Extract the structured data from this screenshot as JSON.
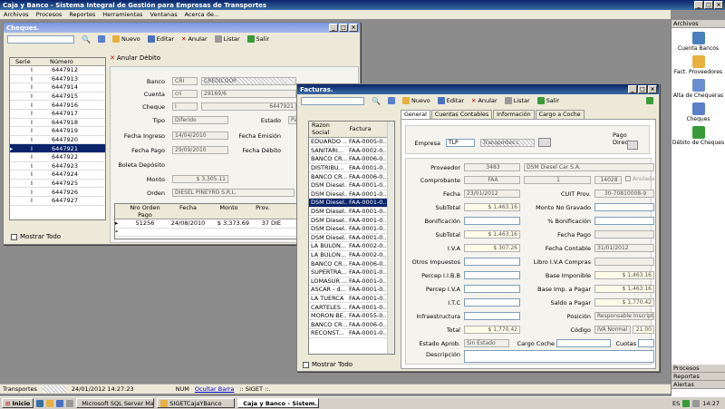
{
  "app": {
    "title": "Caja y Banco - Sistema Integral de Gestión para Empresas de Transportes",
    "menu": [
      "Archivos",
      "Procesos",
      "Reportes",
      "Herramientas",
      "Ventanas",
      "Acerca de..."
    ]
  },
  "cheques_win": {
    "title": "Cheques.",
    "toolbar": {
      "nuevo": "Nuevo",
      "editar": "Editar",
      "anular": "Anular",
      "listar": "Listar",
      "salir": "Salir"
    },
    "grid_headers": [
      "Serie",
      "Número"
    ],
    "rows": [
      [
        "I",
        "6447912"
      ],
      [
        "I",
        "6447913"
      ],
      [
        "I",
        "6447914"
      ],
      [
        "I",
        "6447915"
      ],
      [
        "I",
        "6447916"
      ],
      [
        "I",
        "6447917"
      ],
      [
        "I",
        "6447918"
      ],
      [
        "I",
        "6447919"
      ],
      [
        "I",
        "6447920"
      ],
      [
        "I",
        "6447921"
      ],
      [
        "I",
        "6447922"
      ],
      [
        "I",
        "6447923"
      ],
      [
        "I",
        "6447924"
      ],
      [
        "I",
        "6447925"
      ],
      [
        "I",
        "6447926"
      ],
      [
        "I",
        "6447927"
      ]
    ],
    "mostrar_todo": "Mostrar Todo",
    "anular_debito": "Anular Débito",
    "form": {
      "banco_label": "Banco",
      "banco_code": "CRI",
      "banco_name": "CREDICOOP",
      "cuenta_label": "Cuenta",
      "cuenta_code": "cri",
      "cuenta_num": "29169/6",
      "cheque_label": "Cheque",
      "cheque_serie": "I",
      "cheque_num": "6447921",
      "tipo_label": "Tipo",
      "tipo_value": "Diferido",
      "estado_label": "Estado",
      "estado_value": "Pa",
      "fingreso_label": "Fecha Ingreso",
      "fingreso_value": "14/04/2010",
      "femision_label": "Fecha Emisión",
      "fpago_label": "Fecha Pago",
      "fpago_value": "29/09/2010",
      "fdebito_label": "Fecha Débito",
      "boleta_label": "Boleta Depósito",
      "monto_label": "Monto",
      "monto_value": "$ 3,305.11",
      "orden_label": "Orden",
      "orden_value": "DIESEL PIÑEYRO S.R.L."
    },
    "sub_headers": [
      "Nro Orden Pago",
      "Fecha",
      "Monto",
      "Prov."
    ],
    "sub_row": [
      "51256",
      "24/08/2010",
      "$ 3,373.69",
      "37",
      "DIE"
    ]
  },
  "facturas_win": {
    "title": "Facturas.",
    "toolbar": {
      "nuevo": "Nuevo",
      "editar": "Editar",
      "anular": "Anular",
      "listar": "Listar",
      "salir": "Salir"
    },
    "grid_headers": [
      "Razon Social",
      "Factura"
    ],
    "rows": [
      [
        "EDUARDO ...",
        "FAA-0005-0..."
      ],
      [
        "SANITARI...",
        "FAA-0002-0..."
      ],
      [
        "BANCO CR...",
        "FAA-0006-0..."
      ],
      [
        "DISTRIBU...",
        "FAA-0001-0..."
      ],
      [
        "BANCO CR...",
        "FAA-0006-0..."
      ],
      [
        "DSM Diesel...",
        "FAA-0001-0..."
      ],
      [
        "DSM Diesel...",
        "FAA-0001-0..."
      ],
      [
        "DSM Diesel...",
        "FAA-0001-0..."
      ],
      [
        "DSM Diesel...",
        "FAA-0001-0..."
      ],
      [
        "DSM Diesel...",
        "FAA-0001-0..."
      ],
      [
        "DSM Diesel...",
        "FAA-0001-0..."
      ],
      [
        "DSM Diesel...",
        "FAA-0001-0..."
      ],
      [
        "LA BULON...",
        "FAA-0002-0..."
      ],
      [
        "LA BULON...",
        "FAA-0002-0..."
      ],
      [
        "BANCO CR...",
        "FAA-0006-0..."
      ],
      [
        "SUPERTRA...",
        "FAA-0001-0..."
      ],
      [
        "LOMASUR ...",
        "FAA-0001-0..."
      ],
      [
        "ASCAR - d...",
        "FAA-0001-0..."
      ],
      [
        "LA TUERCA",
        "FAA-0001-0..."
      ],
      [
        "CARTELES ...",
        "FAA-0001-0..."
      ],
      [
        "MORON BE...",
        "FAA-0055-0..."
      ],
      [
        "BANCO CR...",
        "FAA-0006-0..."
      ],
      [
        "RECONST...",
        "FAA-0001-0..."
      ]
    ],
    "selected_index": 7,
    "mostrar_todo": "Mostrar Todo",
    "tabs": [
      "General",
      "Cuentas Contables",
      "Información",
      "Cargo a Coche"
    ],
    "empresa_label": "Empresa",
    "empresa_code": "TLP",
    "empresa_name": "Transportes L",
    "pago_directo": "Pago Directo",
    "f": {
      "proveedor_l": "Proveedor",
      "proveedor_code": "3483",
      "proveedor_name": "DSM Diesel Car S.A.",
      "comprobante_l": "Comprobante",
      "comp_tipo": "FAA",
      "comp_pv": "1",
      "comp_num": "14028",
      "anulada": "Anulada",
      "fecha_l": "Fecha",
      "fecha_v": "23/01/2012",
      "cuit_l": "CUIT Prov.",
      "cuit_v": "30-70810008-9",
      "subtotal_l": "SubTotal",
      "subtotal_v": "$ 1,463.16",
      "montong_l": "Monto No Gravado",
      "bonif_l": "Bonificación",
      "pbonif_l": "% Bonificación",
      "subtotal2_l": "SubTotal",
      "subtotal2_v": "$ 1,463.16",
      "fpago_l": "Fecha Pago",
      "iva_l": "I.V.A",
      "iva_v": "$ 307.26",
      "fcont_l": "Fecha Contable",
      "fcont_v": "31/01/2012",
      "otros_l": "Otros Impuestos",
      "libro_l": "Libro I.V.A Compras",
      "piibb_l": "Percep I.I.B.B",
      "baseimp_l": "Base Imponible",
      "baseimp_v": "$ 1,463.16",
      "piva_l": "Percep I.V.A",
      "baseimpp_l": "Base Imp. a Pagar",
      "baseimpp_v": "$ 1,463.16",
      "itc_l": "I.T.C",
      "saldo_l": "Saldo a Pagar",
      "saldo_v": "$ 1,770.42",
      "infra_l": "Infraestructura",
      "posicion_l": "Posición",
      "posicion_v": "Responsable Inscripto",
      "total_l": "Total",
      "total_v": "$ 1,770.42",
      "codigo_l": "Código",
      "codigo_v": "IVA Normal",
      "codigo_pct": "21.00",
      "estado_l": "Estado Aprob.",
      "estado_v": "Sin Estado",
      "cargo_l": "Cargo Coche",
      "cuotas_l": "Cuotas",
      "desc_l": "Descripción"
    }
  },
  "sidebar": {
    "header": "Archivos",
    "items": [
      "Cuenta Bancos",
      "Fact. Proveedores",
      "Alta de Chequeras",
      "Cheques",
      "Débito de Cheques"
    ],
    "bottom": [
      "Procesos",
      "Reportes",
      "Alertas"
    ]
  },
  "status": {
    "company": "Transportes",
    "datetime": "24/01/2012 14:27:23",
    "num": "NUM",
    "ocultar": "Ocultar Barra",
    "siget": ":: SIGET ::."
  },
  "taskbar": {
    "start": "Inicio",
    "tasks": [
      "Microsoft SQL Server Ma...",
      "SIGETCajaYBanco",
      "Caja y Banco - Sistem..."
    ],
    "lang": "ES",
    "clock": "14:27"
  }
}
